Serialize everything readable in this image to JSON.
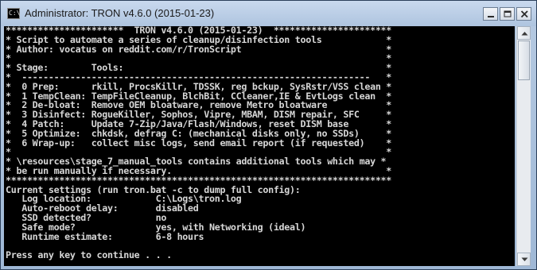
{
  "window": {
    "title": "Administrator:  TRON v4.6.0 (2015-01-23)",
    "sysicon_text": "C:\\",
    "buttons": {
      "minimize": "minimize-icon",
      "maximize": "maximize-icon",
      "close": "close-icon"
    }
  },
  "console": {
    "lines": [
      "**********************  TRON v4.6.0 (2015-01-23)  **********************",
      "* Script to automate a series of cleanup/disinfection tools            *",
      "* Author: vocatus on reddit.com/r/TronScript                           *",
      "*                                                                      *",
      "* Stage:        Tools:                                                 *",
      "*  -----------------------------------------------------------------   *",
      "*  0 Prep:      rkill, ProcsKillr, TDSSK, reg bckup, SysRstr/VSS clean *",
      "*  1 TempClean: TempFileCleanup, BlchBit, CCleaner,IE & EvtLogs clean  *",
      "*  2 De-bloat:  Remove OEM bloatware, remove Metro bloatware           *",
      "*  3 Disinfect: RogueKiller, Sophos, Vipre, MBAM, DISM repair, SFC     *",
      "*  4 Patch:     Update 7-Zip/Java/Flash/Windows, reset DISM base       *",
      "*  5 Optimize:  chkdsk, defrag C: (mechanical disks only, no SSDs)     *",
      "*  6 Wrap-up:   collect misc logs, send email report (if requested)    *",
      "*                                                                      *",
      "* \\resources\\stage_7_manual_tools contains additional tools which may *",
      "* be run manually if necessary.                                        *",
      "************************************************************************",
      "Current settings (run tron.bat -c to dump full config):",
      "   Log location:            C:\\Logs\\tron.log",
      "   Auto-reboot delay:       disabled",
      "   SSD detected?            no",
      "   Safe mode?               yes, with Networking (ideal)",
      "   Runtime estimate:        6-8 hours",
      "",
      "Press any key to continue . . ."
    ]
  }
}
